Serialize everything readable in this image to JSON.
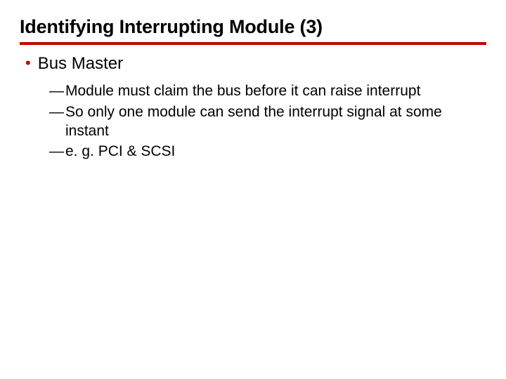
{
  "title": "Identifying Interrupting Module (3)",
  "bullets": [
    {
      "label": "Bus Master",
      "subs": [
        "Module must claim the bus before it can raise interrupt",
        "So only one module can send the interrupt signal at some instant",
        "e. g. PCI & SCSI"
      ]
    }
  ]
}
